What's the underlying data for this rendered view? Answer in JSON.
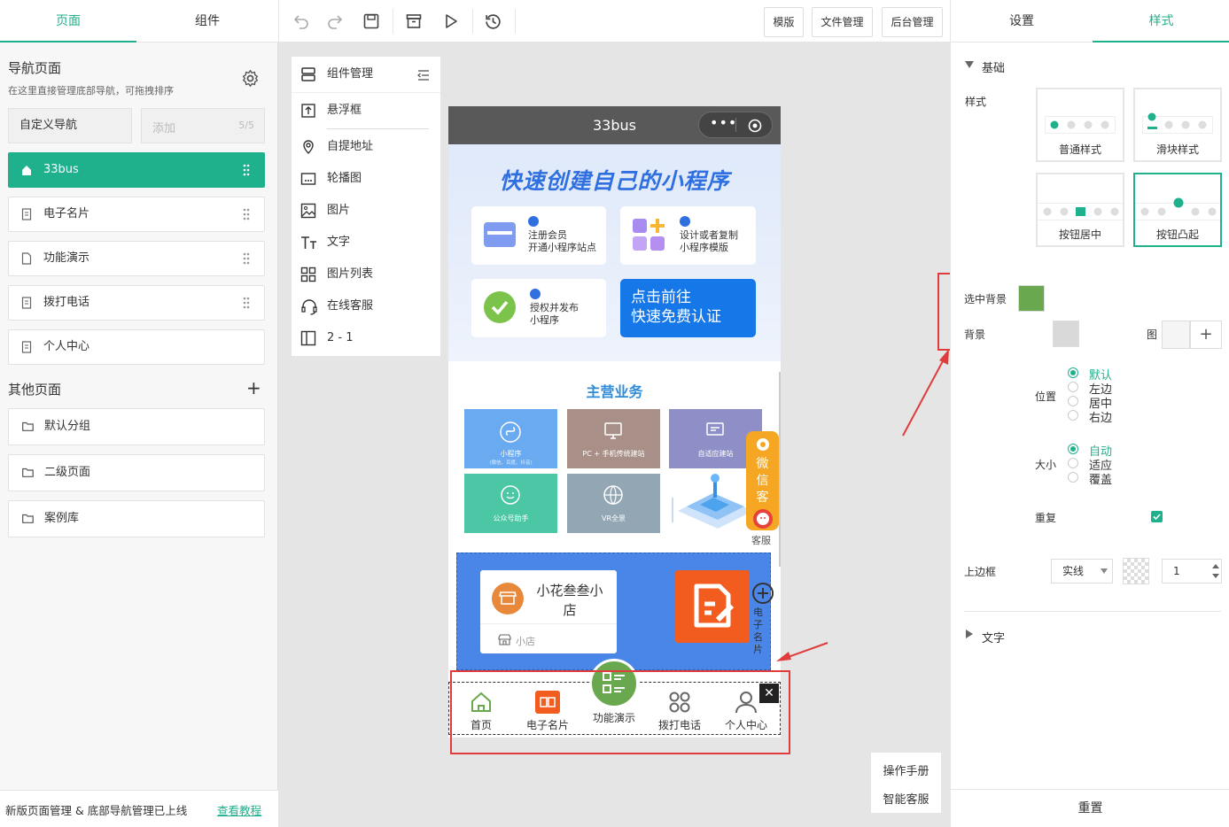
{
  "left_tabs": [
    "页面",
    "组件"
  ],
  "nav": {
    "title": "导航页面",
    "desc": "在这里直接管理底部导航，可拖拽排序",
    "custom_btn": "自定义导航",
    "add_placeholder": "添加",
    "count": "5/5",
    "items": [
      "33bus",
      "电子名片",
      "功能演示",
      "拨打电话",
      "个人中心"
    ]
  },
  "other": {
    "title": "其他页面",
    "groups": [
      "默认分组",
      "二级页面",
      "案例库"
    ]
  },
  "notice": {
    "text": "新版页面管理 & 底部导航管理已上线",
    "link": "查看教程"
  },
  "toolbar": {
    "buttons": [
      "模版",
      "文件管理",
      "后台管理"
    ]
  },
  "components": {
    "title": "组件管理",
    "items": [
      "悬浮框",
      "自提地址",
      "轮播图",
      "图片",
      "文字",
      "图片列表",
      "在线客服",
      "2 - 1"
    ]
  },
  "phone": {
    "title": "33bus",
    "banner": {
      "headline": "快速创建自己的小程序",
      "card1_l1": "注册会员",
      "card1_l2": "开通小程序站点",
      "card2_l1": "设计或者复制",
      "card2_l2": "小程序模版",
      "card3_l1": "授权并发布",
      "card3_l2": "小程序",
      "cta_l1": "点击前往",
      "cta_l2": "快速免费认证"
    },
    "section_title": "主营业务",
    "tiles": [
      {
        "label": "小程序",
        "sub": "(微信、百度、抖音)",
        "color": "#6aaaf0"
      },
      {
        "label": "PC + 手机传统建站",
        "color": "#a89088"
      },
      {
        "label": "自适应建站",
        "color": "#8f8fc8"
      },
      {
        "label": "公众号助手",
        "color": "#4cc7a6"
      },
      {
        "label": "VR全景",
        "color": "#93a6b3"
      }
    ],
    "float_service": {
      "chars": [
        "微",
        "信",
        "客"
      ],
      "label": "客服"
    },
    "card": {
      "shop_name": "小花叁叁小店",
      "shop_tag": "小店",
      "side_label_1": "电子",
      "side_label_2": "名片"
    },
    "tabbar": [
      "首页",
      "电子名片",
      "功能演示",
      "拨打电话",
      "个人中心"
    ]
  },
  "help": {
    "manual": "操作手册",
    "service": "智能客服"
  },
  "right_tabs": [
    "设置",
    "样式"
  ],
  "style_panel": {
    "section_basic": "基础",
    "style_label": "样式",
    "styles": [
      "普通样式",
      "滑块样式",
      "按钮居中",
      "按钮凸起"
    ],
    "selected_bg_label": "选中背景",
    "selected_bg_color": "#6aa84f",
    "bg_label": "背景",
    "bg_color": "#d9d9d9",
    "image_label": "图",
    "position_label": "位置",
    "positions": [
      "默认",
      "左边",
      "居中",
      "右边"
    ],
    "size_label": "大小",
    "sizes": [
      "自动",
      "适应",
      "覆盖"
    ],
    "repeat_label": "重复",
    "border_label": "上边框",
    "border_style": "实线",
    "border_width": "1",
    "section_text": "文字",
    "reset": "重置"
  },
  "colors": {
    "accent": "#1fb08c",
    "annotation": "#e03c3c"
  }
}
